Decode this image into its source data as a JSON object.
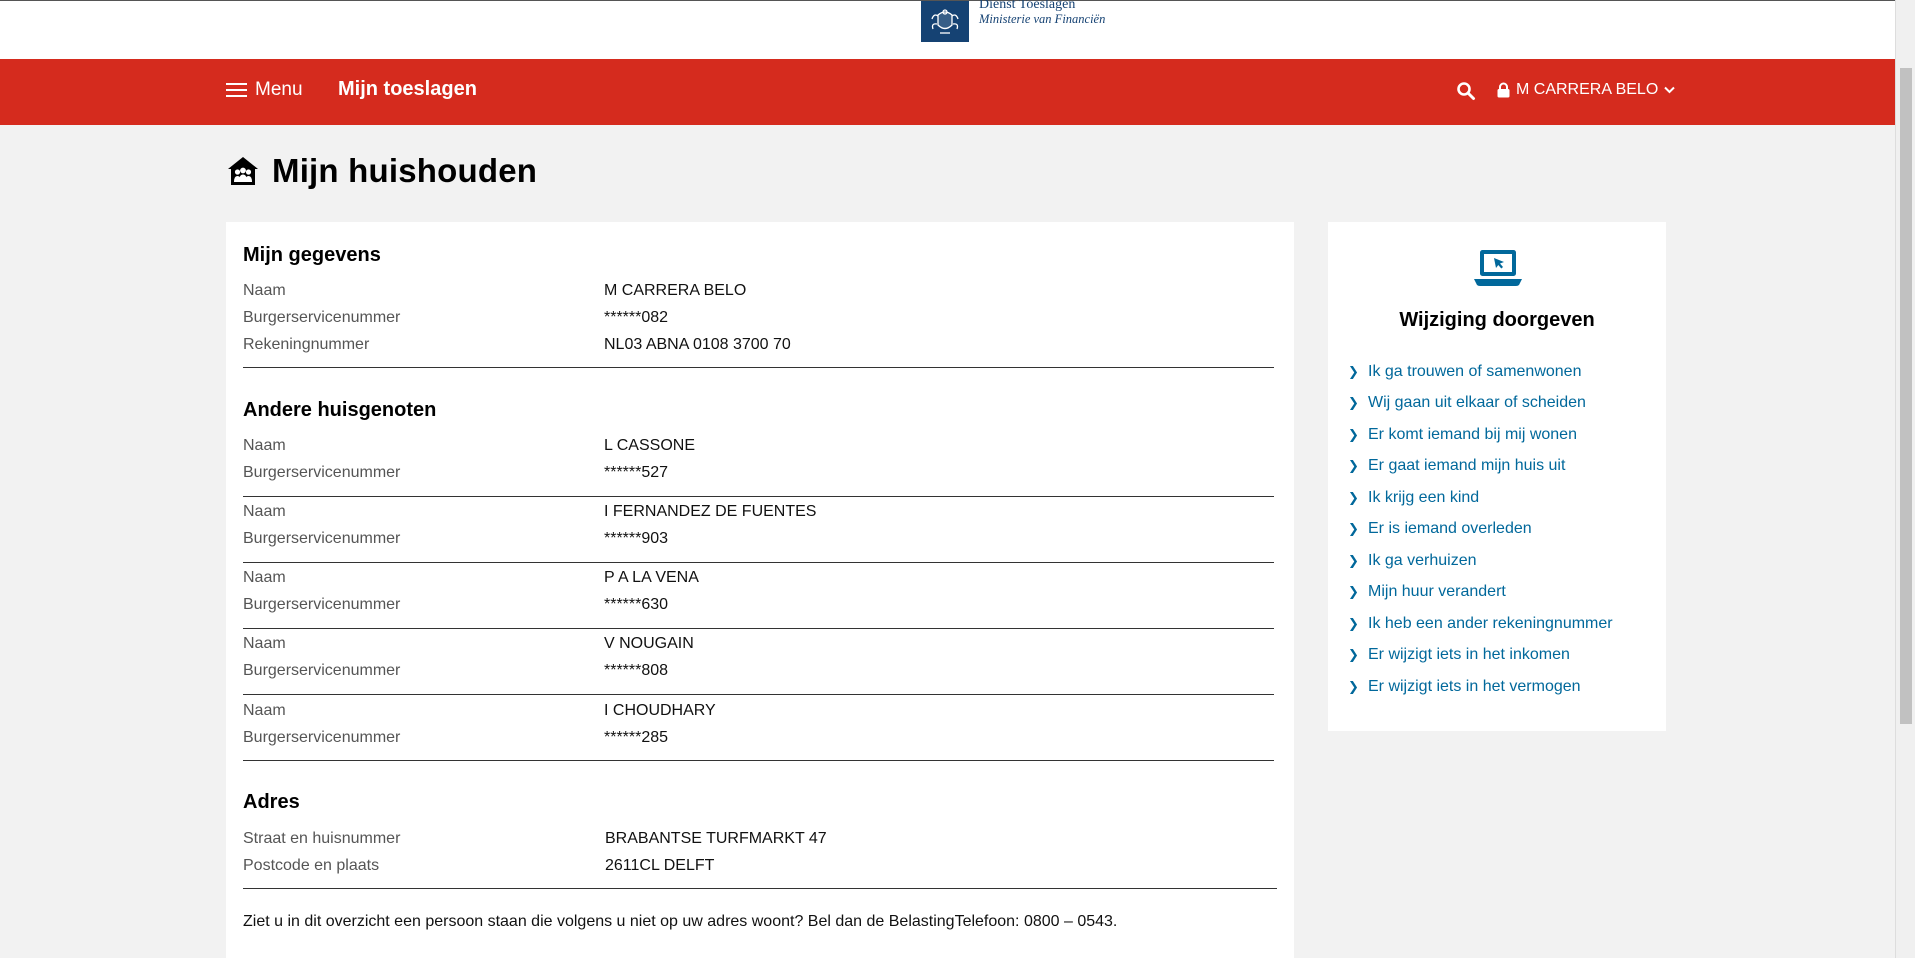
{
  "branding": {
    "line1": "Dienst Toeslagen",
    "line2": "Ministerie van Financiën",
    "logo_icon": "coat-of-arms-icon"
  },
  "nav": {
    "menu_label": "Menu",
    "title": "Mijn toeslagen",
    "user_name": "M CARRERA BELO",
    "colors": {
      "background": "#d52b1e",
      "text": "#ffffff"
    }
  },
  "page": {
    "title": "Mijn huishouden",
    "title_icon": "house-people-icon"
  },
  "mijn_gegevens": {
    "heading": "Mijn gegevens",
    "rows": [
      {
        "label": "Naam",
        "value": "M CARRERA BELO"
      },
      {
        "label": "Burgerservicenummer",
        "value": "******082"
      },
      {
        "label": "Rekeningnummer",
        "value": "NL03 ABNA 0108 3700 70"
      }
    ]
  },
  "andere_huisgenoten": {
    "heading": "Andere huisgenoten",
    "persons": [
      {
        "name_label": "Naam",
        "name": "L CASSONE",
        "bsn_label": "Burgerservicenummer",
        "bsn": "******527"
      },
      {
        "name_label": "Naam",
        "name": "I FERNANDEZ DE FUENTES",
        "bsn_label": "Burgerservicenummer",
        "bsn": "******903"
      },
      {
        "name_label": "Naam",
        "name": "P A LA VENA",
        "bsn_label": "Burgerservicenummer",
        "bsn": "******630"
      },
      {
        "name_label": "Naam",
        "name": "V NOUGAIN",
        "bsn_label": "Burgerservicenummer",
        "bsn": "******808"
      },
      {
        "name_label": "Naam",
        "name": "I CHOUDHARY",
        "bsn_label": "Burgerservicenummer",
        "bsn": "******285"
      }
    ]
  },
  "adres": {
    "heading": "Adres",
    "rows": [
      {
        "label": "Straat en huisnummer",
        "value": "BRABANTSE TURFMARKT 47"
      },
      {
        "label": "Postcode en plaats",
        "value": "2611CL DELFT"
      }
    ]
  },
  "footnote": "Ziet u in dit overzicht een persoon staan die volgens u niet op uw adres woont? Bel dan de BelastingTelefoon: 0800 – 0543.",
  "sidebar": {
    "icon": "laptop-pointer-icon",
    "title": "Wijziging doorgeven",
    "links": [
      "Ik ga trouwen of samenwonen",
      "Wij gaan uit elkaar of scheiden",
      "Er komt iemand bij mij wonen",
      "Er gaat iemand mijn huis uit",
      "Ik krijg een kind",
      "Er is iemand overleden",
      "Ik ga verhuizen",
      "Mijn huur verandert",
      "Ik heb een ander rekeningnummer",
      "Er wijzigt iets in het inkomen",
      "Er wijzigt iets in het vermogen"
    ],
    "link_color": "#01689b"
  }
}
